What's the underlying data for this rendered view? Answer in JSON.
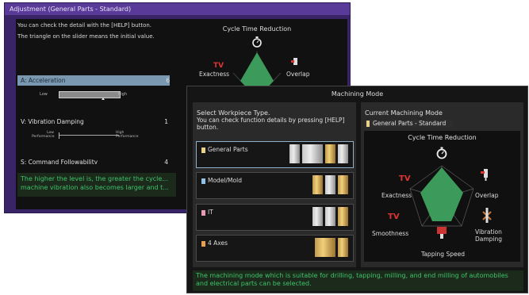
{
  "back_window": {
    "title": "Adjustment (General Parts - Standard)",
    "desc_lines": [
      "You can check the detail with the [HELP] button.",
      "The triangle on the slider means the initial value."
    ],
    "params": [
      {
        "label": "A: Acceleration",
        "value": "6",
        "low": "Low",
        "high": "High",
        "position": 0.6
      },
      {
        "label": "V: Vibration Damping",
        "value": "1",
        "low": "Low Performance",
        "high": "High Performance",
        "position": 0.0
      },
      {
        "label": "S: Command Followability",
        "value": "4"
      }
    ],
    "message": "The higher the level is, the greater the cycle... machine vibration also becomes larger and t...",
    "radar_title": "Cycle Time Reduction",
    "radar_labels": {
      "left": "Exactness",
      "right": "Overlap"
    }
  },
  "front_window": {
    "title": "Machining Mode",
    "left": {
      "header": "Select Workpiece Type.",
      "desc": "You can check function details by pressing [HELP] button.",
      "items": [
        {
          "name": "General Parts",
          "color": "#e9d18a",
          "selected": true
        },
        {
          "name": "Model/Mold",
          "color": "#8fc3e8",
          "selected": false
        },
        {
          "name": "IT",
          "color": "#e79bb9",
          "selected": false
        },
        {
          "name": "4 Axes",
          "color": "#e8a050",
          "selected": false
        }
      ]
    },
    "right": {
      "header": "Current Machining Mode",
      "current": "General Parts - Standard",
      "radar": {
        "title": "Cycle Time Reduction",
        "labels": [
          "Exactness",
          "Overlap",
          "Smoothness",
          "Vibration Damping",
          "Tapping Speed"
        ]
      }
    },
    "message": "The machining mode which is suitable for drilling, tapping, milling, and end milling of automobiles and electrical parts can be selected."
  }
}
